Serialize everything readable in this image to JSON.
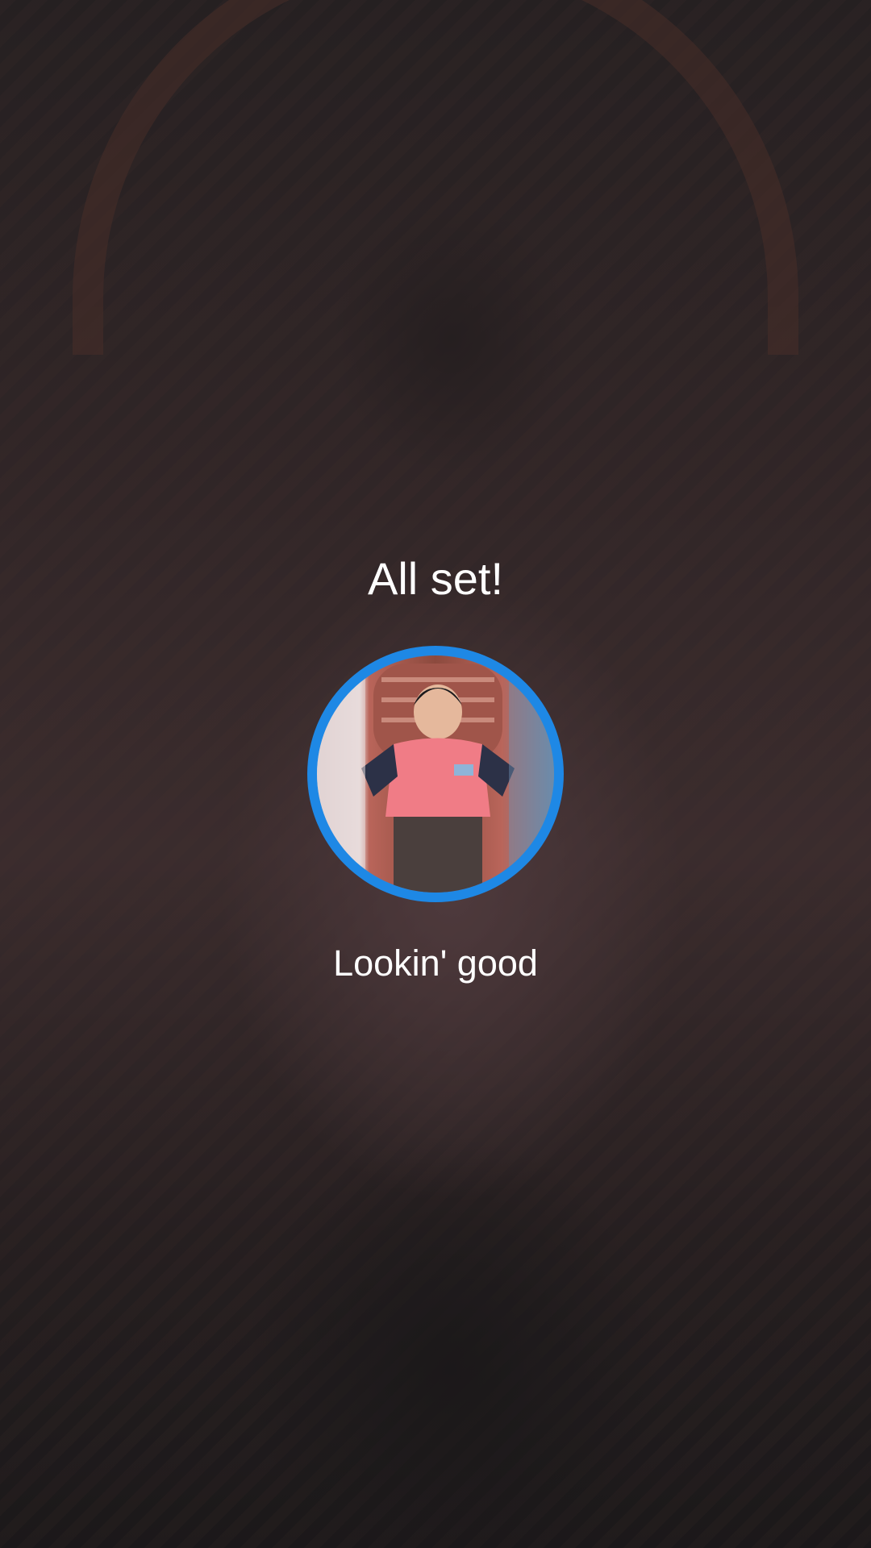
{
  "screen": {
    "title": "All set!",
    "subtitle": "Lookin' good"
  },
  "avatar": {
    "icon": "profile-photo",
    "ring_color": "#1e88e5"
  }
}
